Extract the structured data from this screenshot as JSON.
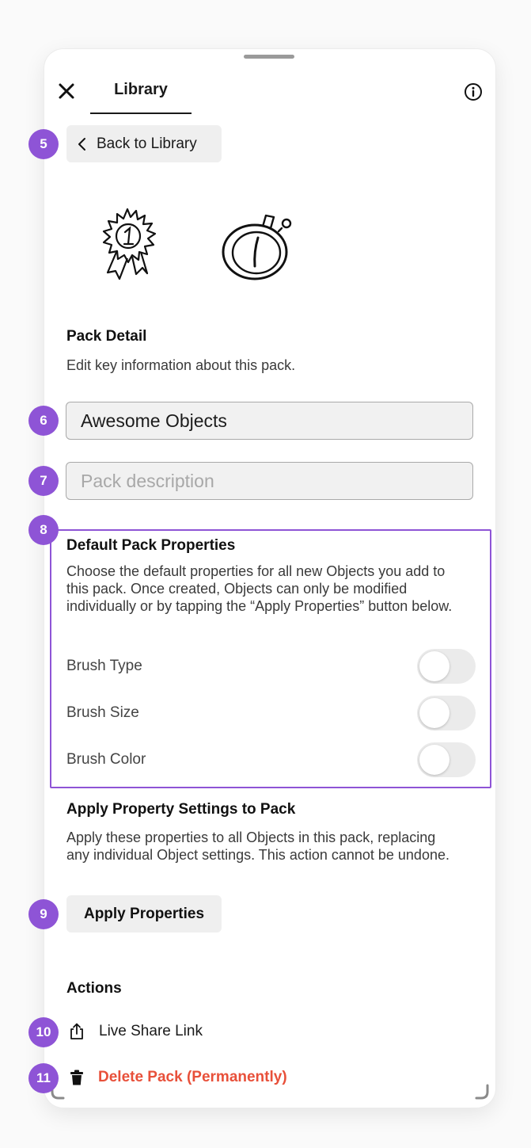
{
  "header": {
    "close_icon": "close-icon",
    "tab_label": "Library",
    "info_icon": "info-icon"
  },
  "back_button": {
    "label": "Back to Library",
    "icon": "chevron-left-icon"
  },
  "thumbnails": [
    {
      "name": "ribbon-award-icon"
    },
    {
      "name": "stopwatch-icon"
    }
  ],
  "pack_detail": {
    "title": "Pack Detail",
    "subtitle": "Edit key information about this pack.",
    "name_value": "Awesome Objects",
    "description_value": "",
    "description_placeholder": "Pack description"
  },
  "default_properties": {
    "title": "Default Pack Properties",
    "description": "Choose the default properties for all new Objects you add to this pack. Once created, Objects can only be modified individually or by tapping the “Apply Properties” button below.",
    "rows": [
      {
        "label": "Brush Type",
        "enabled": false
      },
      {
        "label": "Brush Size",
        "enabled": false
      },
      {
        "label": "Brush Color",
        "enabled": false
      }
    ]
  },
  "apply_section": {
    "title": "Apply Property Settings to Pack",
    "description": "Apply these properties to all Objects in this pack, replacing any individual Object settings. This action cannot be undone.",
    "button_label": "Apply Properties"
  },
  "actions": {
    "title": "Actions",
    "share_label": "Live Share Link",
    "share_icon": "share-icon",
    "delete_label": "Delete Pack (Permanently)",
    "delete_icon": "trash-icon"
  },
  "annotations": [
    "5",
    "6",
    "7",
    "8",
    "9",
    "10",
    "11"
  ],
  "colors": {
    "annotation": "#8e54d6",
    "destructive": "#e8503a",
    "button_bg": "#efefef",
    "toggle_off": "#ebebeb"
  }
}
